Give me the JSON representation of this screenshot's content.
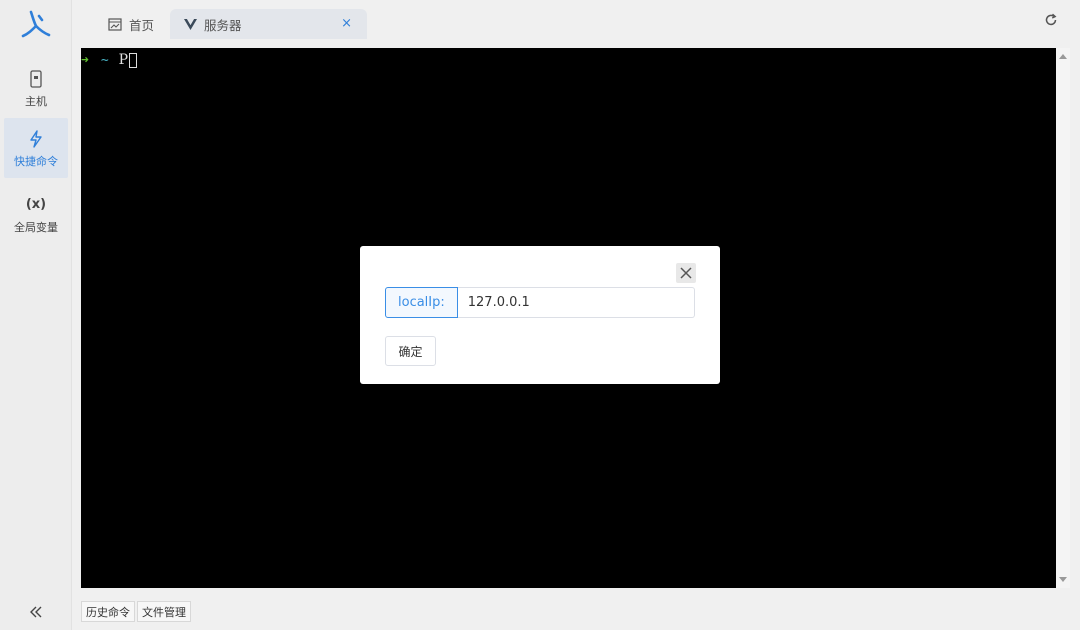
{
  "sidebar": {
    "items": [
      {
        "label": "主机",
        "icon": "host-icon"
      },
      {
        "label": "快捷命令",
        "icon": "lightning-icon",
        "active": true
      },
      {
        "label": "全局变量",
        "icon": "variable-icon",
        "glyph": "(x)"
      }
    ],
    "collapse_icon": "double-chevron-left-icon"
  },
  "tabs": [
    {
      "label": "首页",
      "icon": "dashboard-icon"
    },
    {
      "label": "服务器",
      "icon": "vue-logo-icon",
      "active": true,
      "close": "×"
    }
  ],
  "terminal": {
    "prompt_symbol": "➜",
    "cwd": "~",
    "typed": "P"
  },
  "bottom_tabs": [
    "历史命令",
    "文件管理"
  ],
  "dialog": {
    "field_label": "localIp:",
    "field_value": "127.0.0.1",
    "confirm_label": "确定"
  },
  "colors": {
    "accent": "#2f7fd9",
    "terminal_bg": "#000000",
    "prompt_arrow": "#5fbf2e",
    "prompt_cwd": "#48b3c4"
  }
}
